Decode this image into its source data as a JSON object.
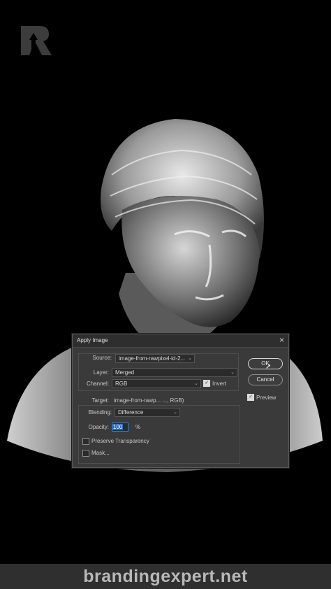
{
  "dialog": {
    "title": "Apply Image",
    "source": {
      "label": "Source:",
      "value": "image-from-rawpixel-id-2..."
    },
    "layer": {
      "label": "Layer:",
      "value": "Merged"
    },
    "channel": {
      "label": "Channel:",
      "value": "RGB",
      "invert_label": "Invert",
      "invert_checked": true
    },
    "target": {
      "label": "Target:",
      "value": "image-from-rawp... ..., RGB)"
    },
    "blending": {
      "label": "Blending:",
      "value": "Difference"
    },
    "opacity": {
      "label": "Opacity:",
      "value": "100",
      "unit": "%"
    },
    "preserve_transparency": {
      "label": "Preserve Transparency",
      "checked": false
    },
    "mask": {
      "label": "Mask...",
      "checked": false
    },
    "buttons": {
      "ok": "OK",
      "cancel": "Cancel"
    },
    "preview": {
      "label": "Preview",
      "checked": true
    }
  },
  "footer": {
    "text": "brandingexpert.net"
  },
  "colors": {
    "dialog_bg": "#3a3a3a",
    "footer_bg": "#2f2f2f",
    "highlight": "#2a66bd"
  }
}
